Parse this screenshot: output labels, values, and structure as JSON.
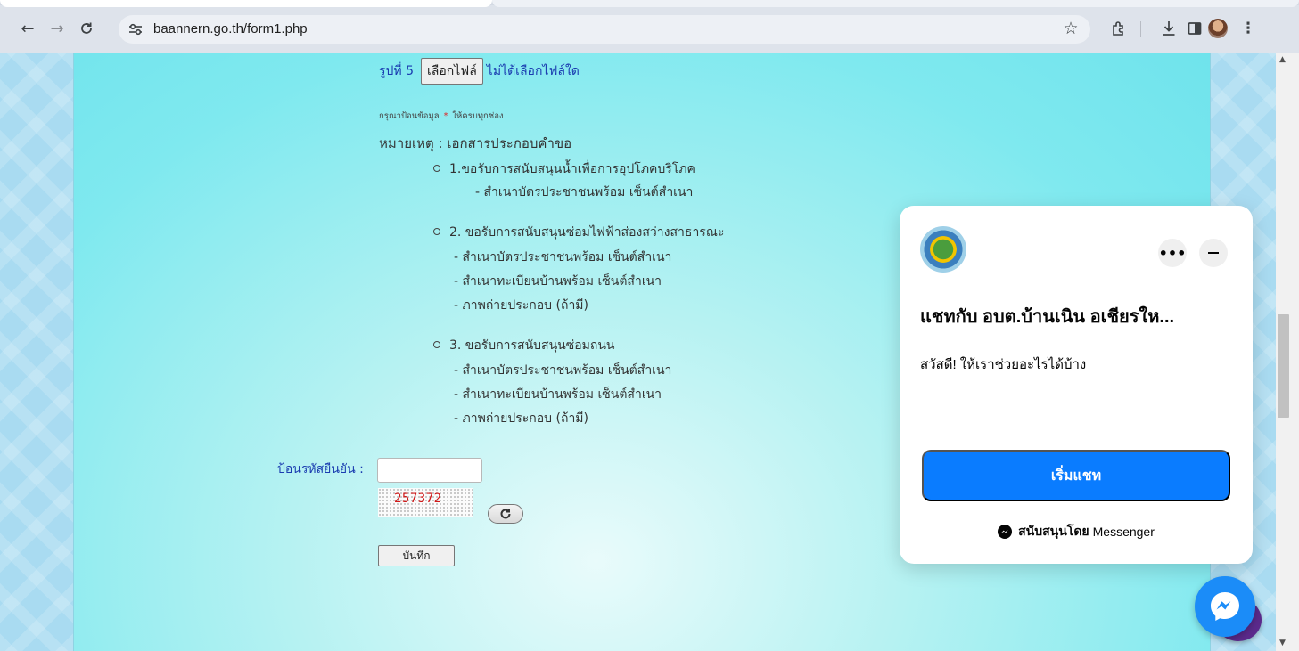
{
  "browser": {
    "url": "baannern.go.th/form1.php"
  },
  "form": {
    "file_row": {
      "label": "รูปที่ 5",
      "button": "เลือกไฟล์",
      "no_file": "ไม่ได้เลือกไฟล์ใด"
    },
    "required_note": {
      "before": "กรุณาป้อนข้อมูล",
      "mark": "*",
      "after": "ให้ครบทุกช่อง"
    },
    "remark_title": "หมายเหตุ : เอกสารประกอบคำขอ",
    "items": [
      {
        "title": "1.ขอรับการสนับสนุนน้ำเพื่อการอุปโภคบริโภค",
        "docs": [
          "- สำเนาบัตรประชาชนพร้อม เซ็นต์สำเนา"
        ]
      },
      {
        "title": "2. ขอรับการสนับสนุนซ่อมไฟฟ้าส่องสว่างสาธารณะ",
        "docs": [
          "- สำเนาบัตรประชาชนพร้อม เซ็นต์สำเนา",
          "- สำเนาทะเบียนบ้านพร้อม เซ็นต์สำเนา",
          "- ภาพถ่ายประกอบ (ถ้ามี)"
        ]
      },
      {
        "title": "3. ขอรับการสนับสนุนซ่อมถนน",
        "docs": [
          "- สำเนาบัตรประชาชนพร้อม เซ็นต์สำเนา",
          "- สำเนาทะเบียนบ้านพร้อม เซ็นต์สำเนา",
          "- ภาพถ่ายประกอบ (ถ้ามี)"
        ]
      }
    ],
    "captcha_label": "ป้อนรหัสยืนยัน :",
    "captcha_value": "",
    "captcha_code": "257372",
    "save_button": "บันทึก"
  },
  "chat": {
    "title": "แชทกับ อบต.บ้านเนิน อเชียรให...",
    "greeting": "สวัสดี! ให้เราช่วยอะไรได้บ้าง",
    "start_button": "เริ่มแชท",
    "footer_bold": "สนับสนุนโดย",
    "footer_brand": "Messenger",
    "messenger_color": "#0a7cff"
  }
}
